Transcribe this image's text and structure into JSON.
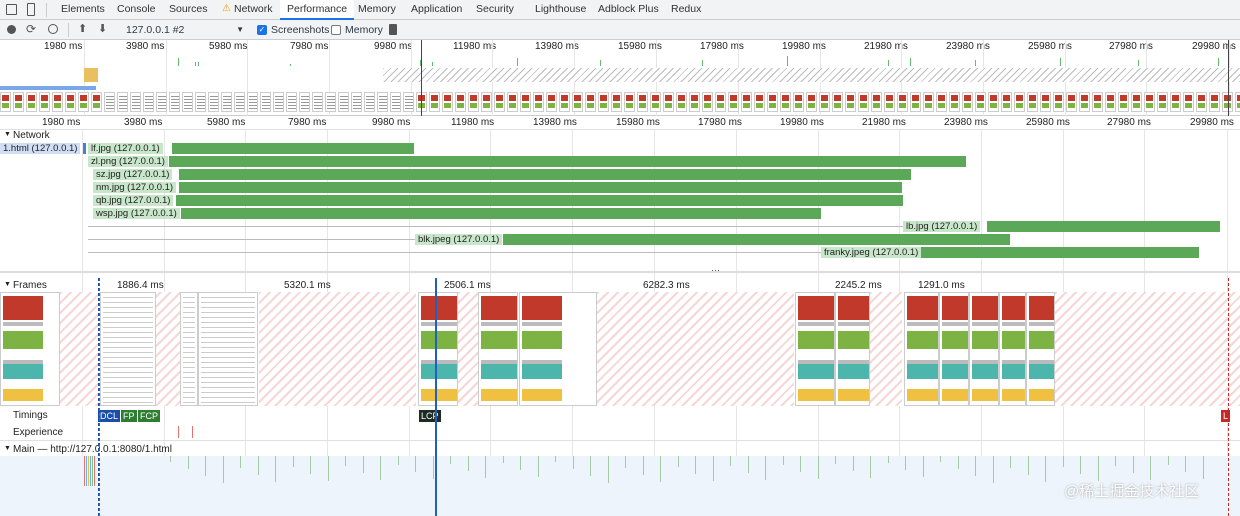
{
  "tabs": [
    "Elements",
    "Console",
    "Sources",
    "Network",
    "Performance",
    "Memory",
    "Application",
    "Security",
    "Lighthouse",
    "Adblock Plus",
    "Redux"
  ],
  "active_tab": "Performance",
  "toolbar": {
    "session_select": "127.0.0.1 #2",
    "screenshots_label": "Screenshots",
    "screenshots_checked": true,
    "memory_label": "Memory",
    "memory_checked": false
  },
  "ruler_ticks": [
    "1980 ms",
    "3980 ms",
    "5980 ms",
    "7980 ms",
    "9980 ms",
    "11980 ms",
    "13980 ms",
    "15980 ms",
    "17980 ms",
    "19980 ms",
    "21980 ms",
    "23980 ms",
    "25980 ms",
    "27980 ms",
    "29980 ms"
  ],
  "network": {
    "title": "Network",
    "requests": [
      {
        "label": "1.html (127.0.0.1)"
      },
      {
        "label": "lf.jpg (127.0.0.1)"
      },
      {
        "label": "zl.png (127.0.0.1)"
      },
      {
        "label": "sz.jpg (127.0.0.1)"
      },
      {
        "label": "nm.jpg (127.0.0.1)"
      },
      {
        "label": "qb.jpg (127.0.0.1)"
      },
      {
        "label": "wsp.jpg (127.0.0.1)"
      },
      {
        "label": "lb.jpg (127.0.0.1)"
      },
      {
        "label": "blk.jpeg (127.0.0.1)"
      },
      {
        "label": "franky.jpeg (127.0.0.1)"
      }
    ]
  },
  "frames": {
    "title": "Frames",
    "durations": [
      "1886.4 ms",
      "5320.1 ms",
      "2506.1 ms",
      "6282.3 ms",
      "2245.2 ms",
      "1291.0 ms"
    ]
  },
  "timings": {
    "title": "Timings",
    "markers": [
      {
        "label": "DCL",
        "color": "#1a4ea8"
      },
      {
        "label": "FP",
        "color": "#2e7d32"
      },
      {
        "label": "FCP",
        "color": "#2e7d32"
      },
      {
        "label": "LCP",
        "color": "#1e2a24"
      },
      {
        "label": "L",
        "color": "#c62828"
      }
    ]
  },
  "experience_title": "Experience",
  "main_title": "Main — http://127.0.0.1:8080/1.html",
  "watermark": "@稀土掘金技术社区"
}
